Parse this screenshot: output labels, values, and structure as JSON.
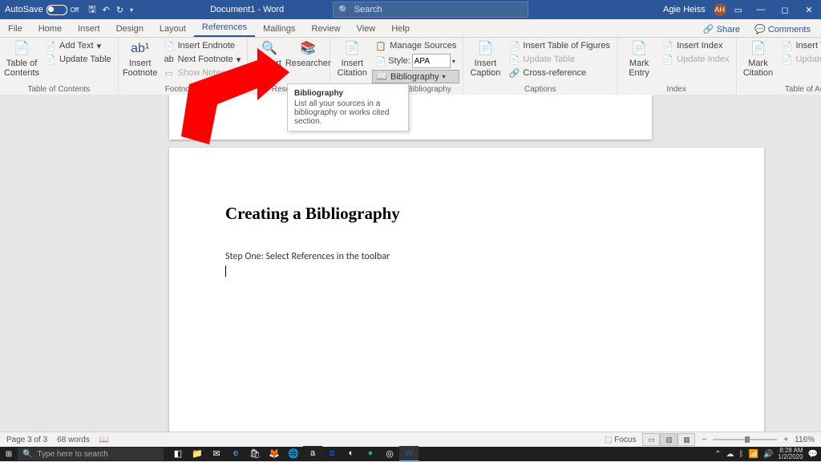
{
  "titlebar": {
    "autosave": "AutoSave",
    "autosave_state": "Off",
    "doc_title": "Document1 - Word",
    "search_placeholder": "Search",
    "username": "Agie Heiss",
    "initials": "AH"
  },
  "tabs": {
    "file": "File",
    "home": "Home",
    "insert": "Insert",
    "design": "Design",
    "layout": "Layout",
    "references": "References",
    "mailings": "Mailings",
    "review": "Review",
    "view": "View",
    "help": "Help",
    "share": "Share",
    "comments": "Comments"
  },
  "ribbon": {
    "toc": {
      "big": "Table of\nContents",
      "add_text": "Add Text",
      "update": "Update Table",
      "label": "Table of Contents"
    },
    "footnotes": {
      "big": "Insert\nFootnote",
      "endnote": "Insert Endnote",
      "next": "Next Footnote",
      "show": "Show Notes",
      "label": "Footnotes"
    },
    "research": {
      "lookup": "Smart\nLookup",
      "researcher": "Researcher",
      "label": "Research"
    },
    "citations": {
      "big": "Insert\nCitation",
      "manage": "Manage Sources",
      "style": "Style:",
      "style_val": "APA",
      "biblio": "Bibliography",
      "label": "Citations & Bibliography"
    },
    "captions": {
      "big": "Insert\nCaption",
      "tof": "Insert Table of Figures",
      "update": "Update Table",
      "xref": "Cross-reference",
      "label": "Captions"
    },
    "index": {
      "big": "Mark\nEntry",
      "insert": "Insert Index",
      "update": "Update Index",
      "label": "Index"
    },
    "toa": {
      "big": "Mark\nCitation",
      "insert": "Insert Table of Authorities",
      "update": "Update Table",
      "label": "Table of Authorities"
    }
  },
  "tooltip": {
    "title": "Bibliography",
    "body": "List all your sources in a bibliography or works cited section."
  },
  "document": {
    "heading": "Creating a Bibliography",
    "line1": "Step One: Select References in the toolbar"
  },
  "status": {
    "page": "Page 3 of 3",
    "words": "68 words",
    "focus": "Focus",
    "zoom": "116%"
  },
  "taskbar": {
    "search": "Type here to search",
    "time": "8:28 AM",
    "date": "1/2/2020"
  }
}
